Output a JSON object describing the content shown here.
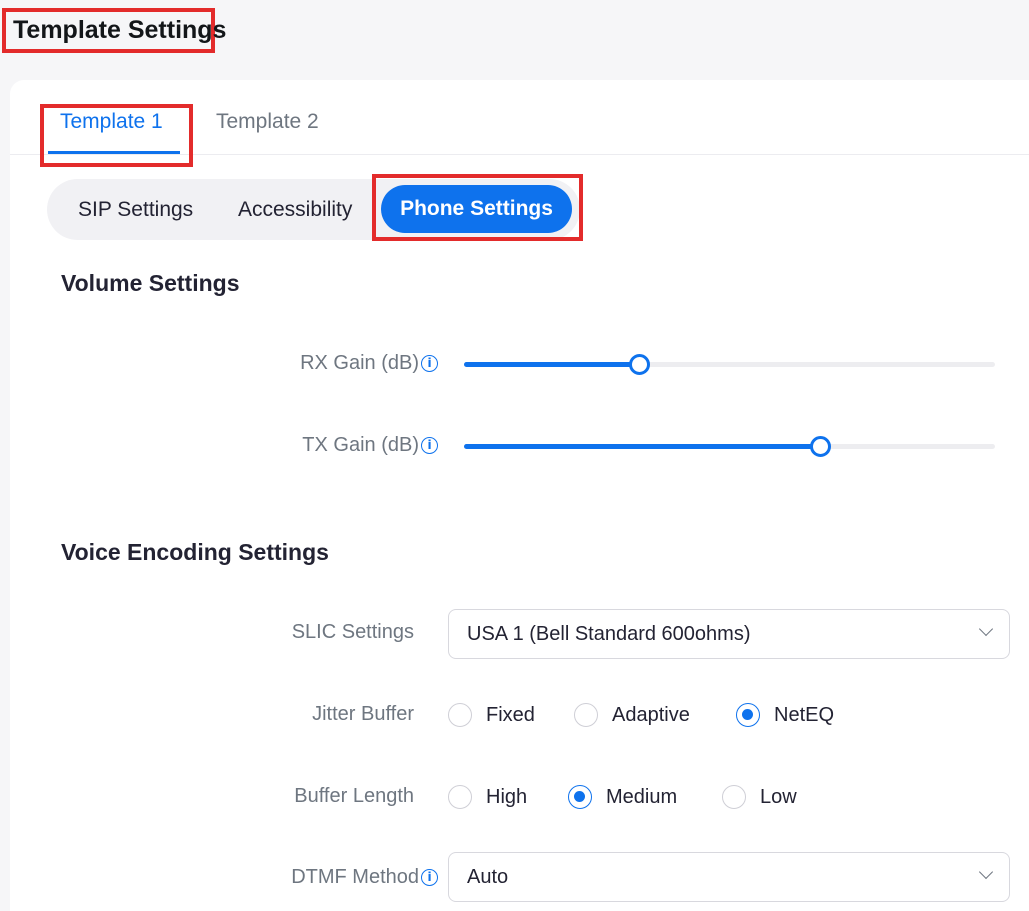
{
  "header": {
    "title": "Template Settings"
  },
  "tabs": [
    {
      "label": "Template 1",
      "active": true
    },
    {
      "label": "Template 2",
      "active": false
    }
  ],
  "segments": [
    {
      "label": "SIP Settings",
      "active": false
    },
    {
      "label": "Accessibility",
      "active": false
    },
    {
      "label": "Phone Settings",
      "active": true
    }
  ],
  "volume": {
    "title": "Volume Settings",
    "rx_label": "RX Gain (dB)",
    "rx_level_percent": 33,
    "tx_label": "TX Gain (dB)",
    "tx_level_percent": 67
  },
  "voice": {
    "title": "Voice Encoding Settings",
    "slic_label": "SLIC Settings",
    "slic_value": "USA 1 (Bell Standard 600ohms)",
    "jitter_label": "Jitter Buffer",
    "jitter_options": [
      "Fixed",
      "Adaptive",
      "NetEQ"
    ],
    "jitter_selected": "NetEQ",
    "buffer_label": "Buffer Length",
    "buffer_options": [
      "High",
      "Medium",
      "Low"
    ],
    "buffer_selected": "Medium",
    "dtmf_label": "DTMF Method",
    "dtmf_value": "Auto"
  },
  "colors": {
    "accent": "#0e72ed",
    "highlight": "#e32b2b"
  },
  "icons": {
    "info": "info-icon",
    "dropdown": "chevron-down-icon"
  }
}
